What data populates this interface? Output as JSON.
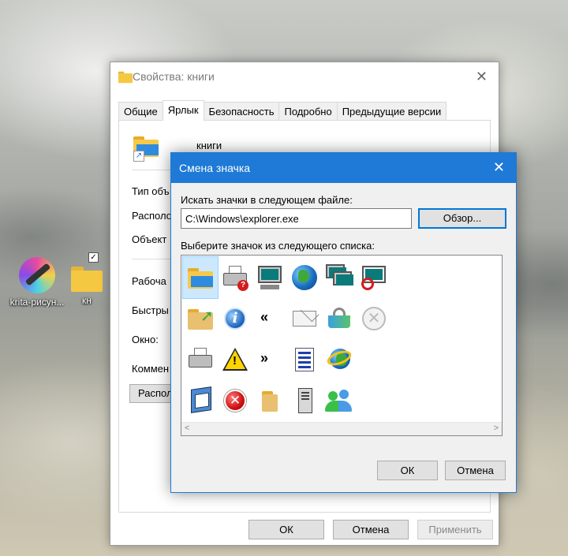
{
  "desktop": {
    "icons": [
      {
        "label": "krita-рисун..."
      },
      {
        "label": "кн"
      }
    ]
  },
  "props_window": {
    "title": "Свойства: книги",
    "tabs": [
      "Общие",
      "Ярлык",
      "Безопасность",
      "Подробно",
      "Предыдущие версии"
    ],
    "active_tab": "Ярлык",
    "file_name": "книги",
    "fields": [
      "Тип объ",
      "Располо",
      "Объект",
      "Рабоча",
      "Быстры",
      "Окно:",
      "Коммен"
    ],
    "location_button": "Располо",
    "ok": "ОК",
    "cancel": "Отмена",
    "apply": "Применить"
  },
  "change_icon_dialog": {
    "title": "Смена значка",
    "search_label": "Искать значки в следующем файле:",
    "path": "C:\\Windows\\explorer.exe",
    "browse": "Обзор...",
    "list_label": "Выберите значок из следующего списка:",
    "ok": "ОК",
    "cancel": "Отмена",
    "quote_left": "«",
    "quote_right": "»",
    "icons": [
      "folder-blue-icon",
      "printer-help-icon",
      "computer-icon",
      "globe-icon",
      "windows-icon",
      "blocked-window-icon",
      "folder-arrow-icon",
      "info-icon",
      "quote-left-icon",
      "envelope-icon",
      "basket-icon",
      "gray-x-icon",
      "printer-icon",
      "warning-icon",
      "quote-right-icon",
      "word-doc-icon",
      "ie-globe-icon",
      "presentation-icon",
      "error-icon",
      "folder-open-icon",
      "computer-tower-icon",
      "users-icon"
    ]
  }
}
